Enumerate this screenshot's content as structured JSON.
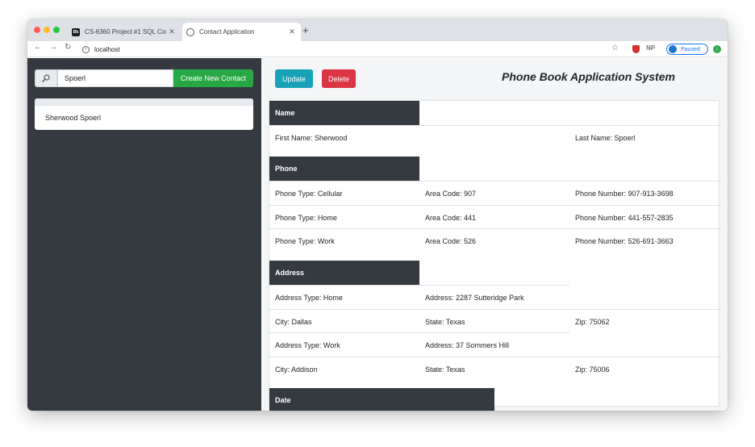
{
  "browser": {
    "tabs": [
      {
        "favicon": "Bb",
        "title": "CS-6360 Project #1 SQL Contac",
        "close": "✕"
      },
      {
        "title": "Contact Application",
        "close": "✕"
      }
    ],
    "new_tab": "+",
    "url": "localhost",
    "profile_status": "Paused",
    "ext_label": "NP",
    "icons": [
      "back-arrow-icon",
      "forward-arrow-icon",
      "reload-icon",
      "info-icon",
      "star-icon",
      "shield-extension-icon",
      "profile-avatar-icon",
      "update-icon"
    ]
  },
  "sidebar": {
    "search": {
      "value": "Spoerl"
    },
    "create_button": "Create New Contact",
    "contacts": [
      "Sherwood Spoerl"
    ]
  },
  "main": {
    "update_button": "Update",
    "delete_button": "Delete",
    "app_title": "Phone Book Application System",
    "sections": {
      "name": {
        "title": "Name",
        "first": "First Name: Sherwood",
        "last": "Last Name: Spoerl"
      },
      "phone": {
        "title": "Phone",
        "rows": [
          {
            "type": "Phone Type: Cellular",
            "area": "Area Code: 907",
            "number": "Phone Number: 907-913-3698"
          },
          {
            "type": "Phone Type: Home",
            "area": "Area Code: 441",
            "number": "Phone Number: 441-557-2835"
          },
          {
            "type": "Phone Type: Work",
            "area": "Area Code: 526",
            "number": "Phone Number: 526-691-3663"
          }
        ]
      },
      "address": {
        "title": "Address",
        "entries": [
          {
            "type": "Address Type: Home",
            "address": "Address: 2287 Sutteridge Park",
            "city": "City: Dallas",
            "state": "State: Texas",
            "zip": "Zip: 75062"
          },
          {
            "type": "Address Type: Work",
            "address": "Address: 37 Sommers Hill",
            "city": "City: Addison",
            "state": "State: Texas",
            "zip": "Zip: 75006"
          }
        ]
      },
      "date": {
        "title": "Date"
      }
    }
  },
  "colors": {
    "sidebar_bg": "#343a40",
    "create_green": "#28a745",
    "update_teal": "#17a2b8",
    "delete_red": "#dc3545"
  }
}
